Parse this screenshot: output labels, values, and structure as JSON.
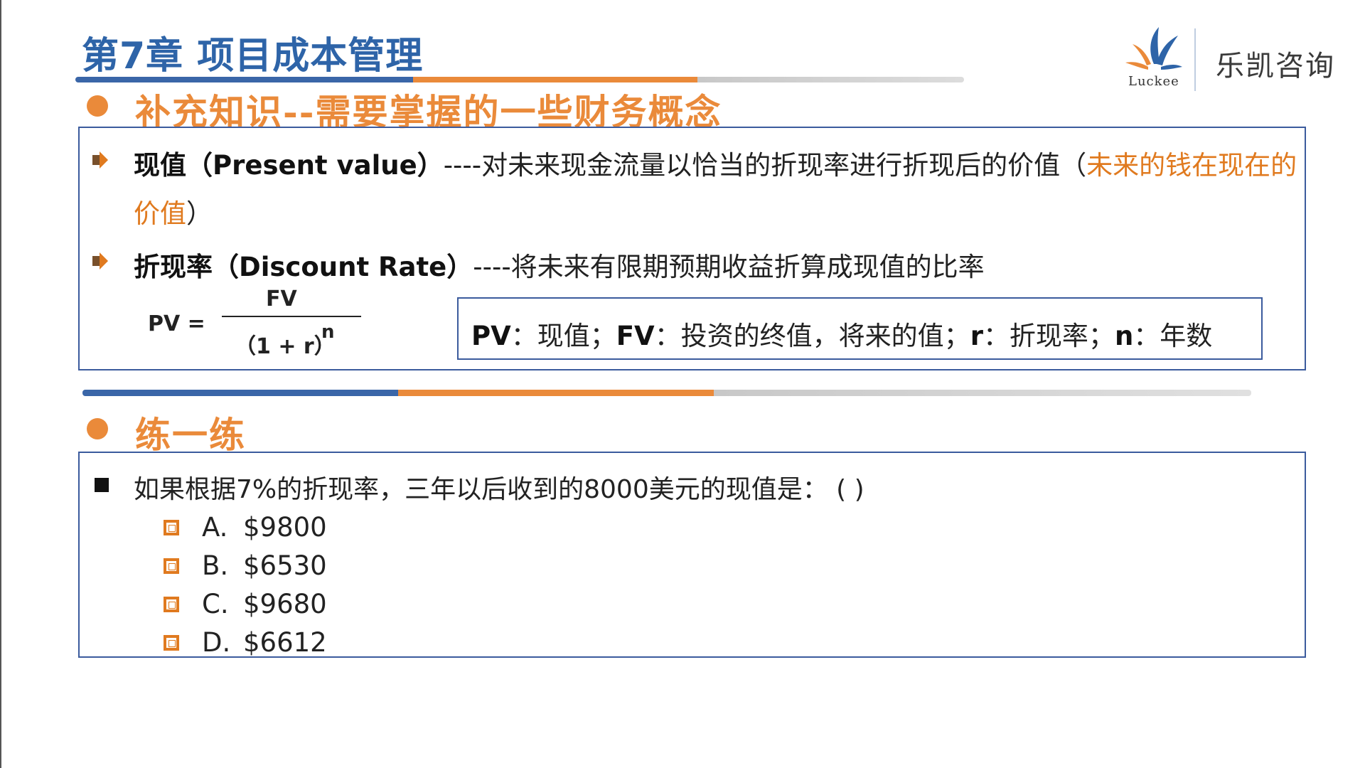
{
  "header": {
    "title": "第7章 项目成本管理",
    "logo_sub": "Luckee",
    "logo_name": "乐凯咨询"
  },
  "section1": {
    "title": "补充知识--需要掌握的一些财务概念",
    "row1": {
      "term": "现值（Present value）",
      "desc": "----对未来现金流量以恰当的折现率进行折现后的价值（",
      "highlight1": "未来的钱在现在的",
      "highlight2": "价值",
      "close": "）"
    },
    "row2": {
      "term": "折现率（Discount Rate）",
      "desc": "----将未来有限期预期收益折算成现值的比率"
    },
    "formula": {
      "lhs": "PV  =",
      "numerator": "FV",
      "denominator": "（1 + r）",
      "exponent": "n"
    },
    "definitions": {
      "pv_term": "PV",
      "pv_desc": "：现值；",
      "fv_term": "FV",
      "fv_desc": "：投资的终值，将来的值；",
      "r_term": "r",
      "r_desc": "：折现率；",
      "n_term": "n",
      "n_desc": "：年数"
    }
  },
  "section2": {
    "title": "练一练",
    "question": "如果根据7%的折现率，三年以后收到的8000美元的现值是：  ( )",
    "options": [
      {
        "letter": "A.",
        "value": "$9800"
      },
      {
        "letter": "B.",
        "value": "$6530"
      },
      {
        "letter": "C.",
        "value": "$9680"
      },
      {
        "letter": "D.",
        "value": "$6612"
      }
    ]
  },
  "colors": {
    "title_blue": "#2e64a8",
    "accent_orange": "#ea8a3a",
    "box_border": "#3b5b9d"
  }
}
